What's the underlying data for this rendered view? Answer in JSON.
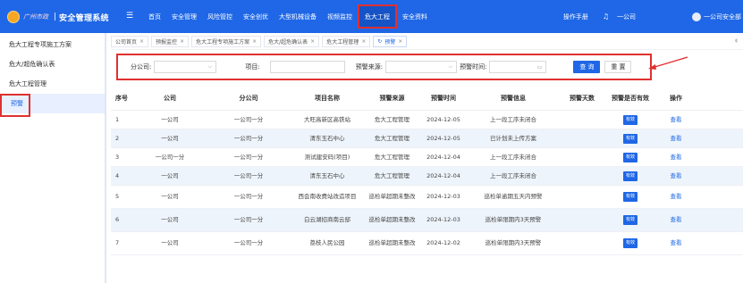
{
  "app": {
    "logo_script": "广州市政",
    "title": "安全管理系统"
  },
  "topnav": [
    "首页",
    "安全管理",
    "风险管控",
    "安全创优",
    "大型机械设备",
    "视频监控",
    "危大工程",
    "安全资料"
  ],
  "topnav_active": "危大工程",
  "top_right": {
    "manual": "操作手册",
    "company": "一公司",
    "user": "一公司安全部"
  },
  "sidebar": {
    "items": [
      "危大工程专项施工方案",
      "危大/超危确认表",
      "危大工程管理",
      "预警"
    ],
    "active": "预警"
  },
  "tabs": [
    {
      "label": "公司首页",
      "active": false
    },
    {
      "label": "预报监控",
      "active": false
    },
    {
      "label": "危大工程专项施工方案",
      "active": false
    },
    {
      "label": "危大/超危确认表",
      "active": false
    },
    {
      "label": "危大工程管理",
      "active": false
    },
    {
      "label": "预警",
      "active": true
    }
  ],
  "filter": {
    "company_label": "分公司:",
    "project_label": "项目:",
    "source_label": "预警来源:",
    "time_label": "预警时间:",
    "query": "查 询",
    "reset": "重 置"
  },
  "table": {
    "headers": [
      "序号",
      "公司",
      "分公司",
      "项目名称",
      "预警来源",
      "预警时间",
      "预警信息",
      "预警天数",
      "预警是否有效",
      "操作"
    ],
    "rows": [
      [
        "1",
        "一公司",
        "一公司一分",
        "大旺高新区高铁站",
        "危大工程管理",
        "2024-12-05",
        "上一段工序未闭合",
        "",
        "有效",
        "查看"
      ],
      [
        "2",
        "一公司",
        "一公司一分",
        "清东玉石中心",
        "危大工程管理",
        "2024-12-05",
        "已计划未上传方案",
        "",
        "有效",
        "查看"
      ],
      [
        "3",
        "一公司一分",
        "一公司一分",
        "测试建安码(项目)",
        "危大工程管理",
        "2024-12-04",
        "上一段工序未闭合",
        "",
        "有效",
        "查看"
      ],
      [
        "4",
        "一公司",
        "一公司一分",
        "清东玉石中心",
        "危大工程管理",
        "2024-12-04",
        "上一段工序未闭合",
        "",
        "有效",
        "查看"
      ],
      [
        "5",
        "一公司",
        "一公司一分",
        "西会南收费站改造项目",
        "巡检单超期未整改",
        "2024-12-03",
        "巡检单逾期五天内预警",
        "",
        "有效",
        "查看"
      ],
      [
        "6",
        "一公司",
        "一公司一分",
        "白云湖招商南云邸",
        "巡检单超期未整改",
        "2024-12-03",
        "巡检单限期内3天预警",
        "",
        "有效",
        "查看"
      ],
      [
        "7",
        "一公司",
        "一公司一分",
        "荔枝人民公园",
        "巡检单超期未整改",
        "2024-12-02",
        "巡检单限期内3天预警",
        "",
        "有效",
        "查看"
      ]
    ]
  },
  "colors": {
    "primary": "#1f67e6",
    "highlight": "#e03030"
  }
}
